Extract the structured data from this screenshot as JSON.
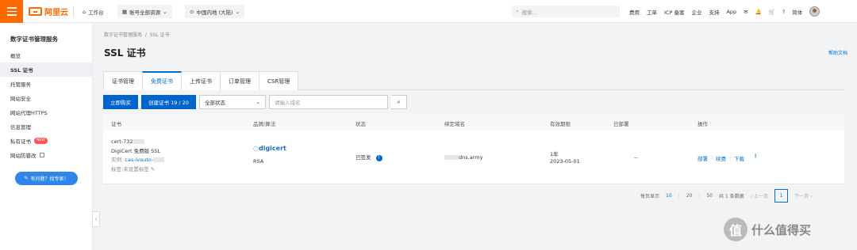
{
  "topbar": {
    "logo": "阿里云",
    "workbench": "工作台",
    "account_resource": "账号全部资源",
    "region": "中国内地 (大陆)",
    "search_placeholder": "搜索...",
    "links": [
      "费用",
      "工单",
      "ICP 备案",
      "企业",
      "支持",
      "App"
    ],
    "lang": "简体"
  },
  "sidebar": {
    "title": "数字证书管理服务",
    "items": [
      {
        "label": "概览"
      },
      {
        "label": "SSL 证书"
      },
      {
        "label": "托管服务"
      },
      {
        "label": "网站安全"
      },
      {
        "label": "网站代理HTTPS"
      },
      {
        "label": "信息管理"
      },
      {
        "label": "私有证书",
        "badge": "NEW"
      },
      {
        "label": "网站防篡改"
      }
    ],
    "help_button": "有问题？找专家！"
  },
  "main": {
    "breadcrumb": [
      "数字证书管理服务",
      "SSL 证书"
    ],
    "title": "SSL 证书",
    "help_doc": "帮助文档",
    "tabs": [
      "证书管理",
      "免费证书",
      "上传证书",
      "订单管理",
      "CSR管理"
    ],
    "buttons": {
      "buy": "立即购买",
      "create": "创建证书 19 / 20"
    },
    "status_select": "全部状态",
    "domain_placeholder": "请输入域名",
    "columns": [
      "证书",
      "品牌/算法",
      "状态",
      "绑定域名",
      "有效期限",
      "已部署",
      "操作"
    ],
    "row": {
      "cert_id": "cert-732",
      "cert_type": "DigiCert 免费版 SSL",
      "instance_label": "实例:",
      "instance_value": "cas-ivauto-",
      "tag_label": "标签:未设置标签",
      "brand": "digicert",
      "algorithm": "RSA",
      "status": "已签发",
      "domain": "dns.army",
      "validity": "1年",
      "expire": "2023-05-01",
      "deployed": "--",
      "actions": [
        "部署",
        "续费",
        "下载"
      ]
    },
    "pager": {
      "per_page_label": "每页显示",
      "sizes": [
        "10",
        "20",
        "50"
      ],
      "total": "共 1 条数据",
      "prev": "上一页",
      "current": "1",
      "next": "下一页"
    }
  },
  "watermark": "什么值得买"
}
